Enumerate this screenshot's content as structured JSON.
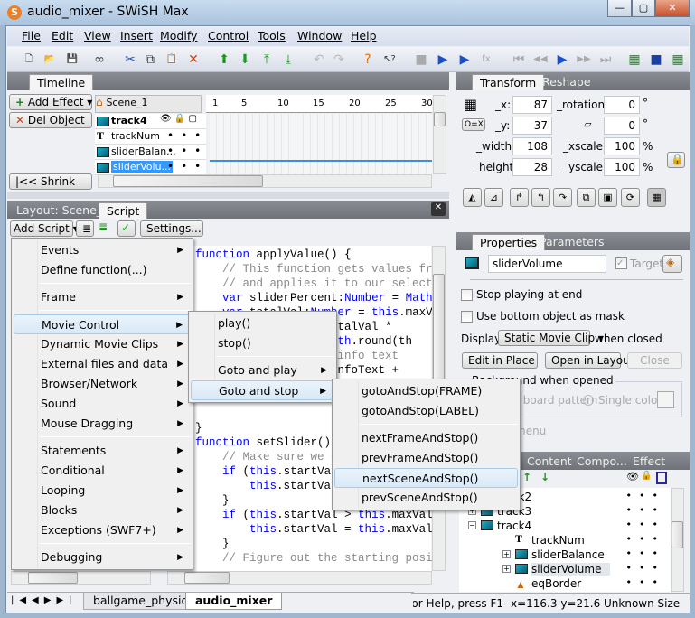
{
  "window": {
    "title": "audio_mixer - SWiSH Max",
    "minimize": "—",
    "maximize": "▢",
    "close": "✕"
  },
  "menubar": [
    {
      "label": "File"
    },
    {
      "label": "Edit"
    },
    {
      "label": "View"
    },
    {
      "label": "Insert"
    },
    {
      "label": "Modify"
    },
    {
      "label": "Control"
    },
    {
      "label": "Tools"
    },
    {
      "label": "Window"
    },
    {
      "label": "Help"
    }
  ],
  "toolbar_icons": [
    "new-icon",
    "open-icon",
    "save-icon",
    "preview-icon",
    "cut-icon",
    "copy-icon",
    "paste-icon",
    "delete-icon",
    "move-up-icon",
    "move-down-icon",
    "move-top-icon",
    "move-bottom-icon",
    "undo-icon",
    "redo-icon",
    "help-icon",
    "context-help-icon",
    "stop-icon",
    "play-icon",
    "play-frame-icon",
    "play-effect-icon",
    "first-frame-icon",
    "prev-frame-icon",
    "play-marker-icon",
    "next-frame-icon",
    "last-frame-icon",
    "insert-scene-icon",
    "insert-button-icon",
    "insert-sprite-icon"
  ],
  "timeline": {
    "tab": "Timeline",
    "add_effect": "Add Effect",
    "del_object": "Del Object",
    "shrink": "Shrink",
    "scene": "Scene_1",
    "ruler": [
      "1",
      "5",
      "10",
      "15",
      "20",
      "25",
      "30"
    ],
    "rows": [
      {
        "name": "track4",
        "type": "movieclip",
        "bold": true
      },
      {
        "name": "trackNum",
        "type": "text"
      },
      {
        "name": "sliderBalan...",
        "type": "movieclip"
      },
      {
        "name": "sliderVolu...",
        "type": "movieclip",
        "selected": true
      }
    ],
    "dots": "•••"
  },
  "script": {
    "tabs": [
      "Layout: Scene_1",
      "Script"
    ],
    "active_tab": "Script",
    "add_script": "Add Script",
    "settings": "Settings...",
    "lines": [
      {
        "t": "function applyValue() {",
        "c": "kwfn"
      },
      {
        "t": "    // This function gets values from",
        "c": "cm"
      },
      {
        "t": "    // and applies it to our selected",
        "c": "cm"
      },
      {
        "t": "    var sliderPercent:Number = Math.r",
        "c": "code"
      },
      {
        "t": "    var totalVal:Number = this.maxVal",
        "c": "code"
      },
      {
        "t": "                 = totalVal *",
        "c": "code"
      },
      {
        "t": "                 = Math.round(th",
        "c": "code"
      },
      {
        "t": "                e in info text",
        "c": "cm"
      },
      {
        "t": "                his.infoText +",
        "c": "code"
      },
      {
        "t": "",
        "c": "code"
      },
      {
        "t": "",
        "c": "code"
      },
      {
        "t": "",
        "c": "code"
      },
      {
        "t": "}",
        "c": "code"
      },
      {
        "t": "function setSlider() {",
        "c": "kwfn"
      },
      {
        "t": "    // Make sure we di",
        "c": "cm"
      },
      {
        "t": "    if (this.startVal",
        "c": "code"
      },
      {
        "t": "        this.startVal",
        "c": "code"
      },
      {
        "t": "    }",
        "c": "code"
      },
      {
        "t": "    if (this.startVal > this.maxVal)",
        "c": "code"
      },
      {
        "t": "        this.startVal = this.maxVal;",
        "c": "code"
      },
      {
        "t": "    }",
        "c": "code"
      },
      {
        "t": "    // Figure out the starting posit",
        "c": "cm"
      }
    ]
  },
  "add_script_menu": {
    "items": [
      {
        "label": "Events",
        "sub": true
      },
      {
        "label": "Define function(...)"
      },
      {
        "sep": true
      },
      {
        "label": "Frame",
        "sub": true
      },
      {
        "sep": true
      },
      {
        "label": "Movie Control",
        "sub": true,
        "hover": true
      },
      {
        "label": "Dynamic Movie Clips",
        "sub": true
      },
      {
        "label": "External files and data",
        "sub": true
      },
      {
        "label": "Browser/Network",
        "sub": true
      },
      {
        "label": "Sound",
        "sub": true
      },
      {
        "label": "Mouse Dragging",
        "sub": true
      },
      {
        "sep": true
      },
      {
        "label": "Statements",
        "sub": true
      },
      {
        "label": "Conditional",
        "sub": true
      },
      {
        "label": "Looping",
        "sub": true
      },
      {
        "label": "Blocks",
        "sub": true
      },
      {
        "label": "Exceptions (SWF7+)",
        "sub": true
      },
      {
        "sep": true
      },
      {
        "label": "Debugging",
        "sub": true
      }
    ]
  },
  "movie_control_menu": {
    "items": [
      {
        "label": "play()"
      },
      {
        "label": "stop()"
      },
      {
        "sep": true
      },
      {
        "label": "Goto and play",
        "sub": true
      },
      {
        "label": "Goto and stop",
        "sub": true,
        "hover": true
      }
    ]
  },
  "goto_stop_menu": {
    "items": [
      {
        "label": "gotoAndStop(FRAME)"
      },
      {
        "label": "gotoAndStop(LABEL)"
      },
      {
        "sep": true
      },
      {
        "label": "nextFrameAndStop()"
      },
      {
        "label": "prevFrameAndStop()"
      },
      {
        "label": "nextSceneAndStop()",
        "hover": true
      },
      {
        "label": "prevSceneAndStop()"
      }
    ]
  },
  "transform": {
    "tabs": [
      "Transform",
      "Reshape"
    ],
    "x_label": "_x:",
    "x": "87",
    "y_label": "_y:",
    "y": "37",
    "rotation_label": "_rotation:",
    "rotation": "0",
    "skew": "0",
    "width_label": "_width:",
    "width": "108",
    "height_label": "_height:",
    "height": "28",
    "xscale_label": "_xscale:",
    "xscale": "100",
    "yscale_label": "_yscale:",
    "yscale": "100",
    "deg": "°",
    "pct": "%",
    "anchor_btn": "O=X"
  },
  "properties": {
    "tabs": [
      "Properties",
      "Parameters"
    ],
    "name": "sliderVolume",
    "target": "Target",
    "target_checked": true,
    "stop_playing": "Stop playing at end",
    "stop_checked": false,
    "use_mask": "Use bottom object as mask",
    "mask_checked": false,
    "display_label": "Display",
    "display_value": "Static Movie Clip",
    "when_closed": "when closed",
    "edit_in_place": "Edit in Place",
    "open_in_layout": "Open in Layout",
    "close": "Close",
    "bg_group": "Background when opened",
    "checker": "Checkerboard pattern",
    "single_color": "Single color:",
    "menu_frag": "menu"
  },
  "outline": {
    "tabs": [
      "Content",
      "Compo...",
      "Effect"
    ],
    "items": [
      {
        "name": "track2",
        "level": 0
      },
      {
        "name": "track3",
        "level": 0,
        "toggle": "+"
      },
      {
        "name": "track4",
        "level": 0,
        "toggle": "−"
      },
      {
        "name": "trackNum",
        "level": 1,
        "type": "text"
      },
      {
        "name": "sliderBalance",
        "level": 1,
        "toggle": "+"
      },
      {
        "name": "sliderVolume",
        "level": 1,
        "toggle": "+",
        "selected": true
      },
      {
        "name": "eqBorder",
        "level": 1,
        "type": "shape"
      }
    ]
  },
  "doc_tabs": [
    {
      "label": "ballgame_physics"
    },
    {
      "label": "audio_mixer",
      "active": true
    }
  ],
  "status": {
    "help": "For Help, press F1",
    "coords": "x=116.3 y=21.6",
    "size": "Unknown Size"
  }
}
